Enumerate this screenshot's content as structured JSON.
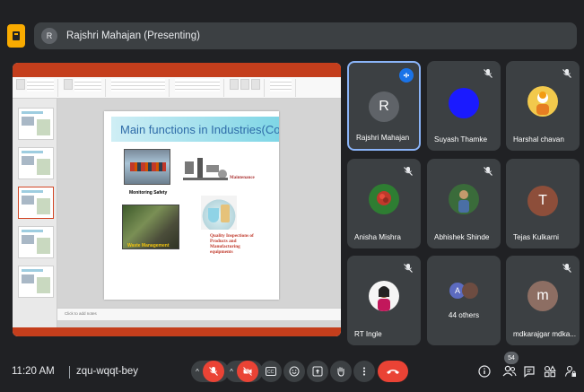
{
  "presenting": {
    "initial": "R",
    "text": "Rajshri Mahajan (Presenting)"
  },
  "slide": {
    "heading": "Main functions in Industries(Contd...)",
    "caption_monitoring": "Monitoring  Safety",
    "caption_maintenance": "Maintenance",
    "caption_waste": "Waste Management",
    "caption_quality": "Quality Inspections of Products and Manufacturing equipments",
    "notes_placeholder": "Click to add notes"
  },
  "participants": [
    {
      "name": "Rajshri Mahajan",
      "initial": "R",
      "avatar_color": "#5f6368",
      "speaking": true
    },
    {
      "name": "Suyash Thamke",
      "initial": "",
      "avatar_color": "#1a1aff",
      "muted": true
    },
    {
      "name": "Harshal chavan",
      "initial": "",
      "avatar_color": "#f2c94c",
      "muted": true
    },
    {
      "name": "Anisha Mishra",
      "initial": "",
      "avatar_color": "#2e7d32",
      "muted": true
    },
    {
      "name": "Abhishek Shinde",
      "initial": "",
      "avatar_color": "#3a6b3a",
      "muted": true
    },
    {
      "name": "Tejas Kulkarni",
      "initial": "T",
      "avatar_color": "#8d4e3a",
      "muted": false
    },
    {
      "name": "RT Ingle",
      "initial": "",
      "avatar_color": "#f5f5f5",
      "muted": true
    },
    {
      "name": "44 others",
      "initial": "A",
      "avatar_color": "#5c6bc0",
      "muted": false
    },
    {
      "name": "mdkarajgar mdka...",
      "initial": "m",
      "avatar_color": "#8d6e63",
      "muted": true
    }
  ],
  "meeting": {
    "time": "11:20 AM",
    "code": "zqu-wqqt-bey",
    "participant_count": "54"
  },
  "colors": {
    "background": "#202124",
    "tile": "#3c4043",
    "accent": "#8ab4f8",
    "danger": "#ea4335",
    "present": "#f9ab00"
  }
}
